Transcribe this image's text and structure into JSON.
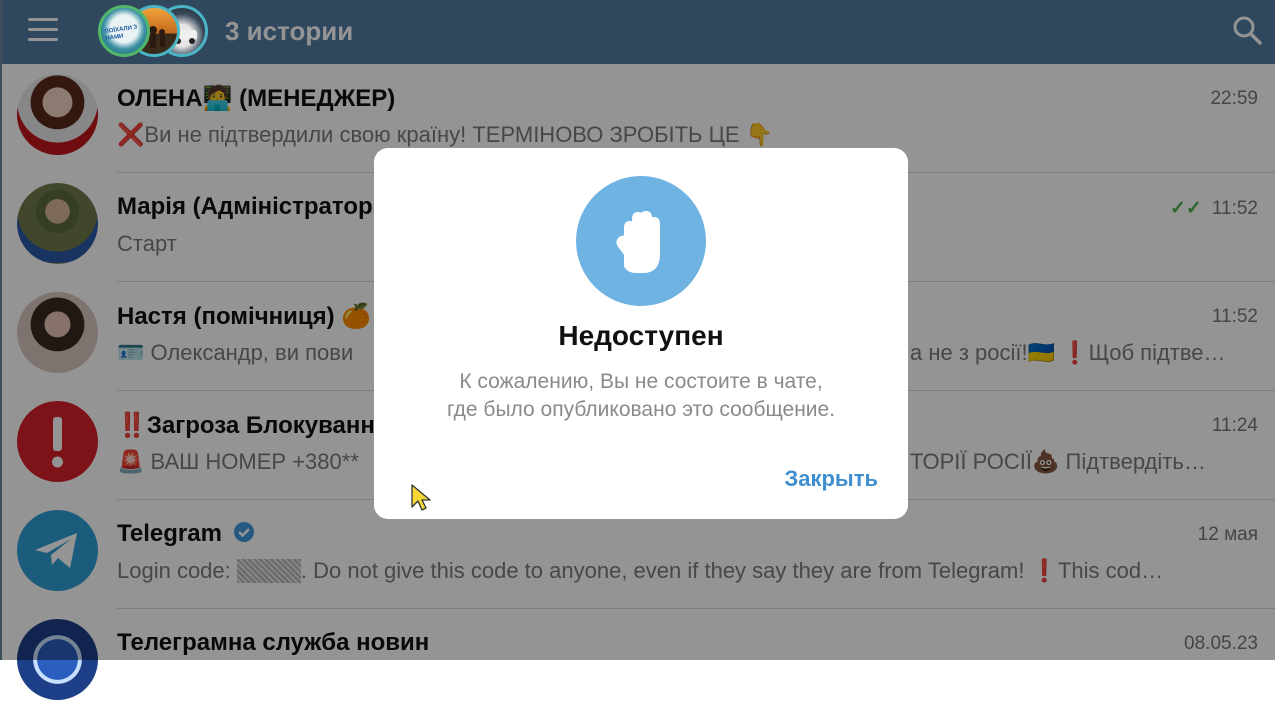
{
  "header": {
    "title": "3 истории",
    "story_logo_text": "ПОЇХАЛИ З НАМИ"
  },
  "chats": [
    {
      "name": "ОЛЕНА",
      "name_suffix": "(МЕНЕДЖЕР)",
      "time": "22:59",
      "message": "Ви не підтвердили свою країну! ТЕРМІНОВО ЗРОБІТЬ ЦЕ",
      "read": false
    },
    {
      "name": "Марія (Адміністратор",
      "time": "11:52",
      "message": "Старт",
      "read": true
    },
    {
      "name": "Настя (помічниця)",
      "time": "11:52",
      "message_left": "Олександр, ви пови",
      "message_right": "а не з росії!",
      "message_right2": "Щоб підтве…"
    },
    {
      "name": "Загроза Блокуванн",
      "time": "11:24",
      "message_left": "ВАШ НОМЕР +380**",
      "message_right": "ТОРІЇ РОСІЇ",
      "message_right2": "Підтвердіть…"
    },
    {
      "name": "Telegram",
      "time": "12 мая",
      "message_left": "Login code:",
      "message_right": ". Do not give this code to anyone, even if they say they are from Telegram!",
      "message_right2": "This cod…"
    },
    {
      "name": "Телеграмна служба новин",
      "time": "08.05.23"
    }
  ],
  "dialog": {
    "title": "Недоступен",
    "text_line1": "К сожалению, Вы не состоите в чате,",
    "text_line2": "где было опубликовано это сообщение.",
    "close_label": "Закрыть"
  },
  "colors": {
    "header": "#517da2",
    "accent": "#3f8fd0",
    "dialog_icon": "#6fb3e3"
  }
}
